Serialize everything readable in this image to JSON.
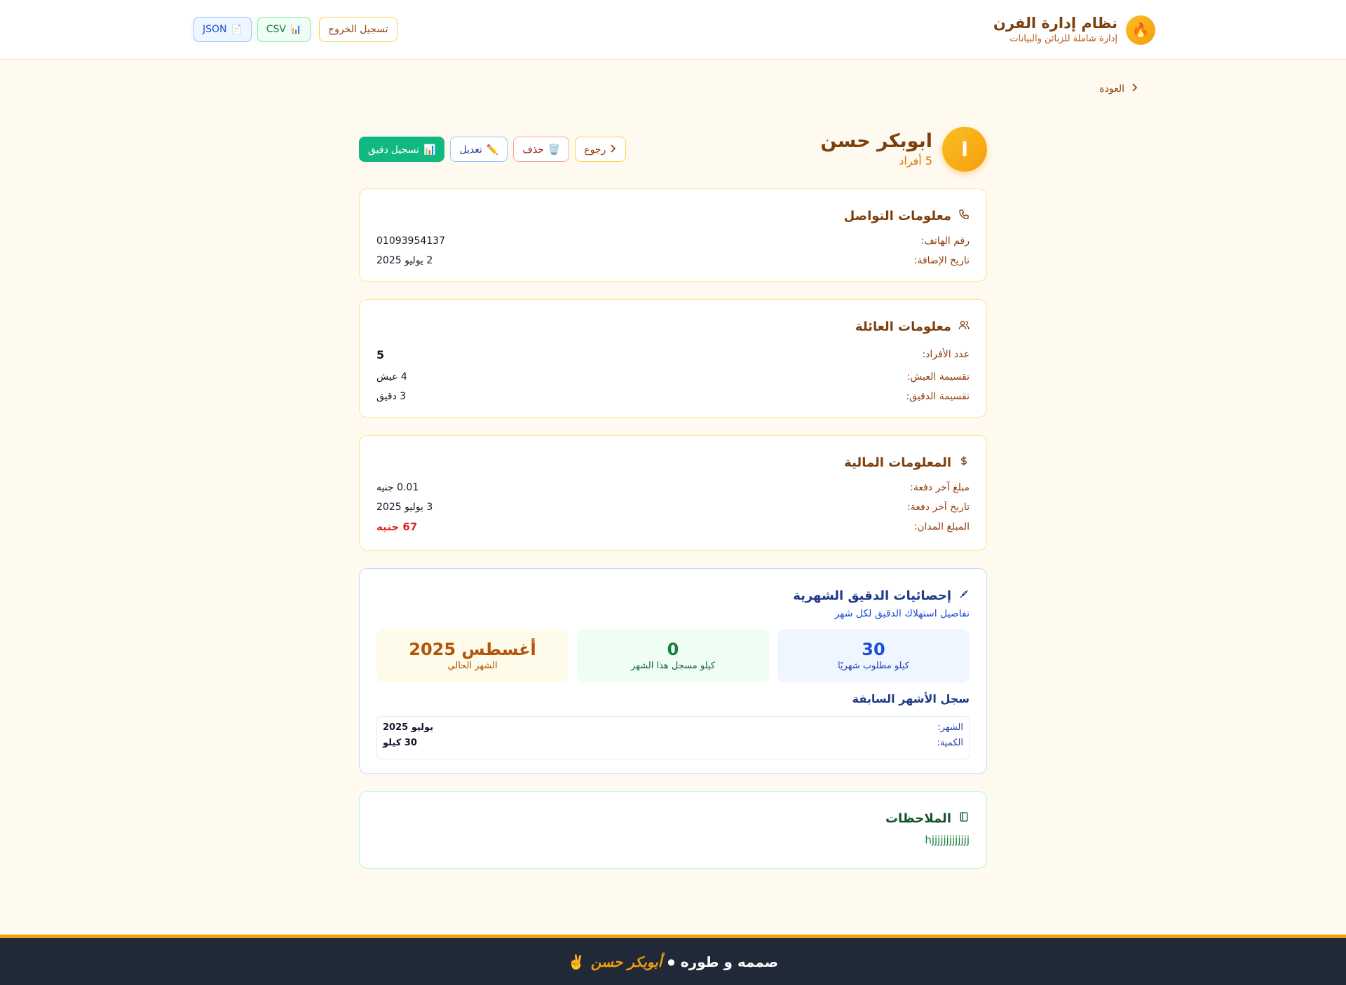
{
  "header": {
    "app_title": "نظام إدارة الفرن",
    "app_subtitle": "إدارة شاملة للزبائن والبيانات",
    "csv_label": "CSV",
    "json_label": "JSON",
    "logout_label": "تسجيل الخروج"
  },
  "nav": {
    "back_label": "العودة"
  },
  "profile": {
    "initial": "ا",
    "name": "ابوبكر حسن",
    "members_text": "5 أفراد",
    "record_flour_label": "تسجيل دقيق",
    "edit_label": "تعديل",
    "delete_label": "حذف",
    "back_label": "رجوع"
  },
  "contact": {
    "title": "معلومات التواصل",
    "phone_label": "رقم الهاتف:",
    "phone_value": "01093954137",
    "added_label": "تاريخ الإضافة:",
    "added_value": "2 يوليو 2025"
  },
  "family": {
    "title": "معلومات العائلة",
    "members_label": "عدد الأفراد:",
    "members_value": "5",
    "bread_label": "تقسيمة العيش:",
    "bread_value": "4 عيش",
    "flour_label": "تقسيمة الدقيق:",
    "flour_value": "3 دقيق"
  },
  "finance": {
    "title": "المعلومات المالية",
    "last_amount_label": "مبلغ آخر دفعة:",
    "last_amount_value": "0.01 جنيه",
    "last_date_label": "تاريخ آخر دفعة:",
    "last_date_value": "3 يوليو 2025",
    "debt_label": "المبلغ المدان:",
    "debt_value": "67 جنيه"
  },
  "stats": {
    "title": "إحصائيات الدقيق الشهرية",
    "subtitle": "تفاصيل استهلاك الدقيق لكل شهر",
    "required": {
      "value": "30",
      "label": "كيلو مطلوب شهريًا"
    },
    "recorded": {
      "value": "0",
      "label": "كيلو مسجل هذا الشهر"
    },
    "current": {
      "value": "أغسطس 2025",
      "label": "الشهر الحالي"
    },
    "history_title": "سجل الأشهر السابقة",
    "history": [
      {
        "month_label": "الشهر:",
        "month_value": "يوليو 2025",
        "qty_label": "الكمية:",
        "qty_value": "30 كيلو"
      }
    ]
  },
  "notes": {
    "title": "الملاحظات",
    "text": "hjjjjjjjjjjjjj"
  },
  "footer": {
    "prefix": "صممه و طوره",
    "author": "أبوبكر حسن",
    "emoji": "✌️"
  },
  "colors": {
    "accent": "#f59e0b",
    "success": "#10b981",
    "danger": "#dc2626",
    "footer_bg": "#1f2937"
  }
}
